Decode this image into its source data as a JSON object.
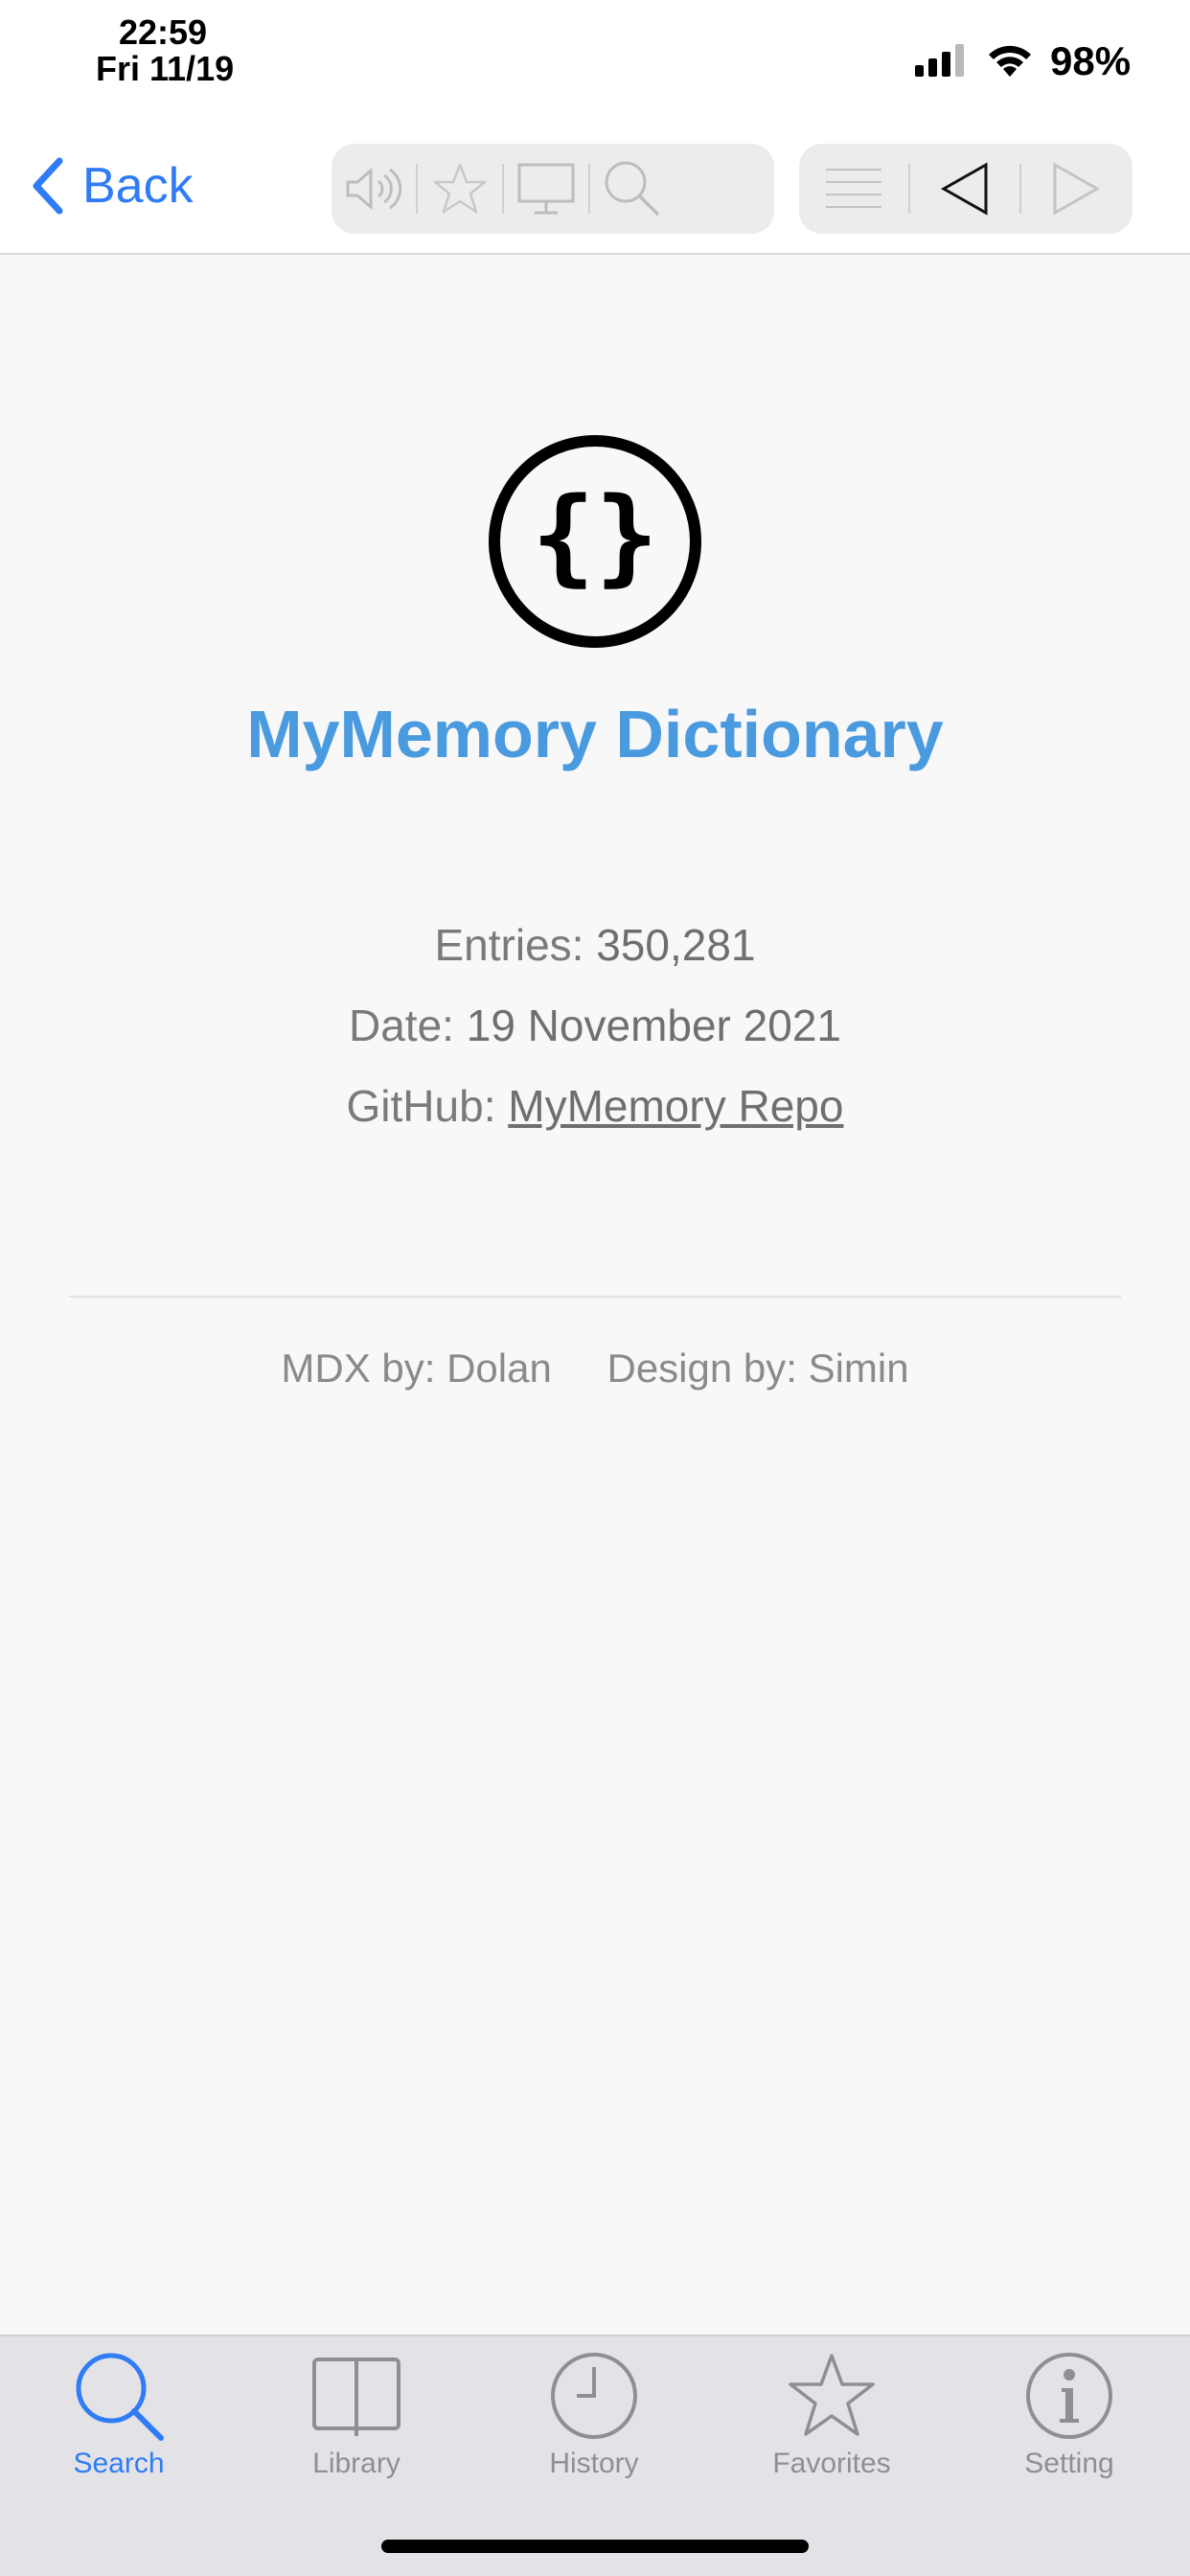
{
  "status_bar": {
    "time": "22:59",
    "date": "Fri 11/19",
    "battery": "98%",
    "icons": [
      "signal-icon",
      "wifi-icon"
    ]
  },
  "nav": {
    "back_label": "Back",
    "toolbar_icons": [
      "speaker-icon",
      "star-icon",
      "monitor-icon",
      "search-icon",
      "list-icon",
      "prev-icon",
      "next-icon"
    ]
  },
  "dictionary": {
    "logo_icon": "curly-braces-icon",
    "title": "MyMemory Dictionary",
    "entries_label": "Entries:",
    "entries_value": "350,281",
    "date_label": "Date:",
    "date_value": "19 November 2021",
    "github_label": "GitHub:",
    "github_link": "MyMemory Repo",
    "mdx_credit": "MDX by: Dolan",
    "design_credit": "Design by: Simin"
  },
  "tabs": [
    {
      "label": "Search",
      "icon": "search-icon",
      "active": true
    },
    {
      "label": "Library",
      "icon": "book-icon",
      "active": false
    },
    {
      "label": "History",
      "icon": "clock-icon",
      "active": false
    },
    {
      "label": "Favorites",
      "icon": "star-icon",
      "active": false
    },
    {
      "label": "Setting",
      "icon": "info-icon",
      "active": false
    }
  ],
  "colors": {
    "accent": "#2f7cf6",
    "title": "#4a9ae0",
    "tab_inactive": "#8e8e93"
  }
}
